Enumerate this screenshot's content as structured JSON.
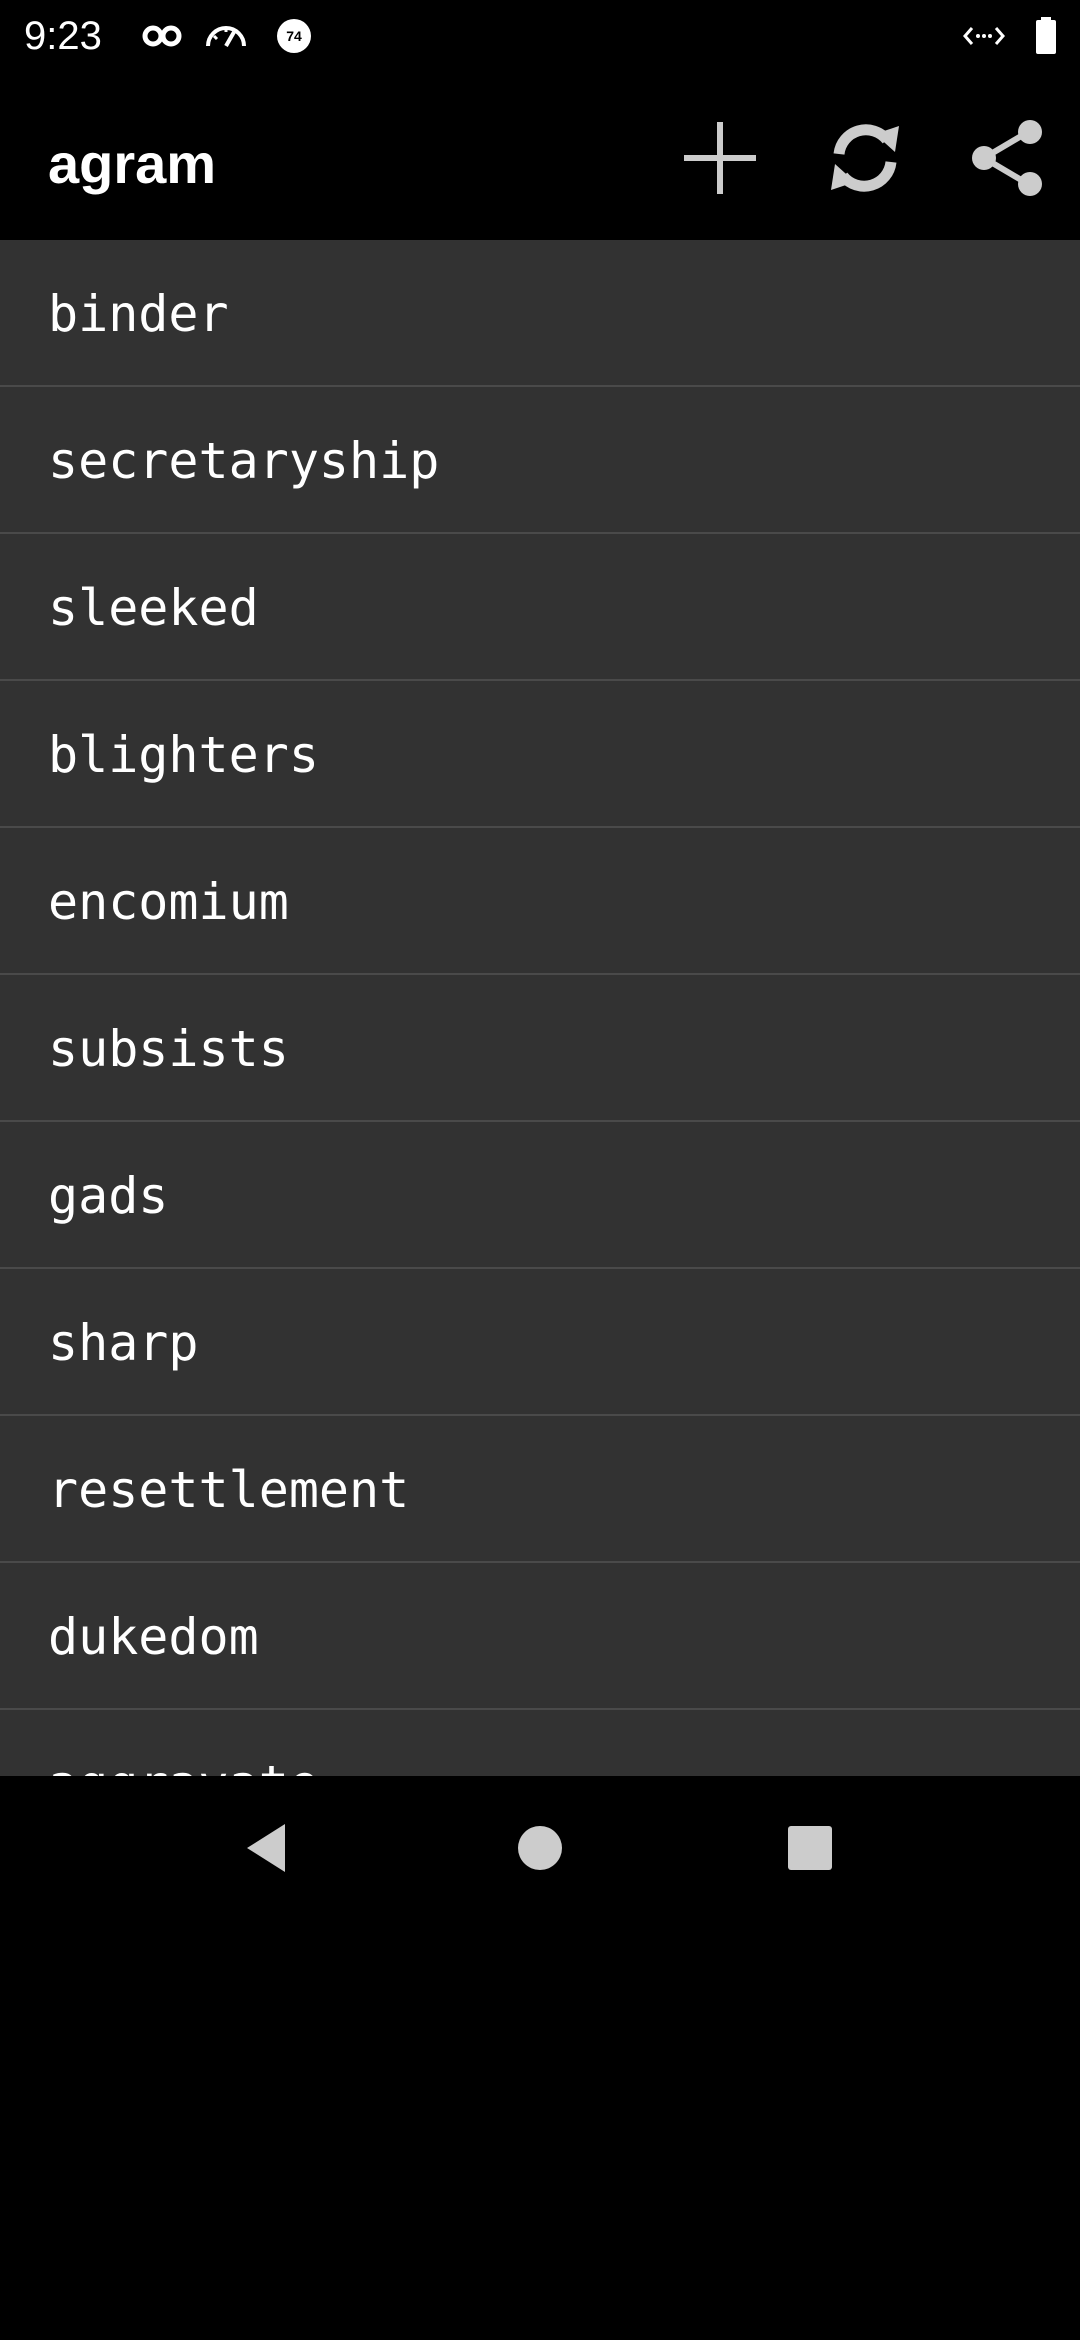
{
  "status_bar": {
    "time": "9:23",
    "icons": [
      "incognito-icon",
      "speedometer-icon",
      "notification-badge-icon",
      "code-brackets-icon",
      "battery-icon"
    ],
    "badge_number": "74"
  },
  "app_bar": {
    "title": "agram",
    "actions": [
      {
        "name": "add",
        "icon": "plus-icon"
      },
      {
        "name": "refresh",
        "icon": "refresh-icon"
      },
      {
        "name": "share",
        "icon": "share-icon"
      }
    ]
  },
  "word_list": {
    "items": [
      "binder",
      "secretaryship",
      "sleeked",
      "blighters",
      "encomium",
      "subsists",
      "gads",
      "sharp",
      "resettlement",
      "dukedom",
      "aggravate"
    ]
  },
  "nav_bar": {
    "buttons": [
      "back-icon",
      "home-icon",
      "recents-icon"
    ]
  },
  "colors": {
    "background": "#000000",
    "list_background": "#323232",
    "divider": "#4a4a4a",
    "icon": "#cccccc",
    "text": "#ffffff"
  }
}
